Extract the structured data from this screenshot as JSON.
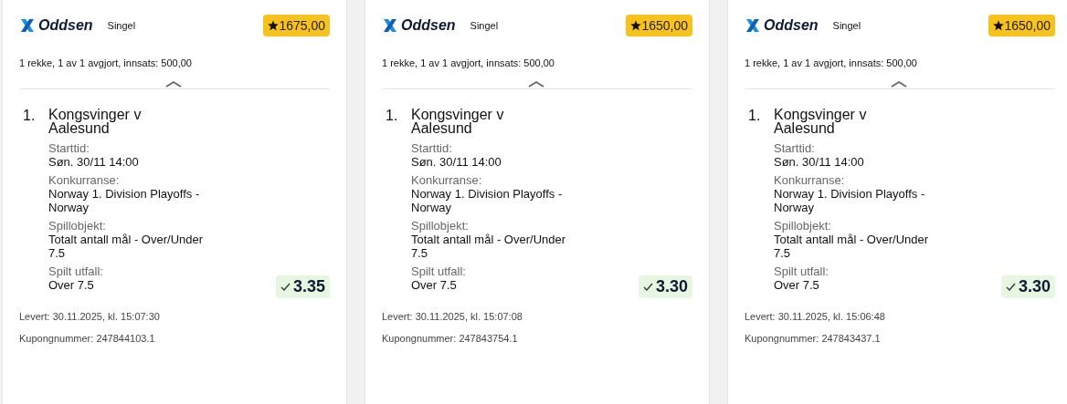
{
  "coupons": [
    {
      "brand": "Oddsen",
      "type": "Singel",
      "payout": "1675,00",
      "summary": "1 rekke, 1 av 1 avgjort, innsats: 500,00",
      "expanded": true,
      "bets": [
        {
          "number": "1.",
          "event": "Kongsvinger v Aalesund",
          "fields": [
            {
              "label": "Starttid:",
              "value": "Søn. 30/11 14:00"
            },
            {
              "label": "Konkurranse:",
              "value": "Norway 1. Division Playoffs - Norway"
            },
            {
              "label": "Spillobjekt:",
              "value": "Totalt antall mål - Over/Under 7.5"
            },
            {
              "label": "Spilt utfall:",
              "value": "Over 7.5"
            }
          ],
          "odds": "3.35",
          "won": true
        }
      ],
      "delivered": "Levert: 30.11.2025, kl. 15:07:30",
      "coupon_number": "Kupongnummer: 247844103.1"
    },
    {
      "brand": "Oddsen",
      "type": "Singel",
      "payout": "1650,00",
      "summary": "1 rekke, 1 av 1 avgjort, innsats: 500,00",
      "expanded": true,
      "bets": [
        {
          "number": "1.",
          "event": "Kongsvinger v Aalesund",
          "fields": [
            {
              "label": "Starttid:",
              "value": "Søn. 30/11 14:00"
            },
            {
              "label": "Konkurranse:",
              "value": "Norway 1. Division Playoffs - Norway"
            },
            {
              "label": "Spillobjekt:",
              "value": "Totalt antall mål - Over/Under 7.5"
            },
            {
              "label": "Spilt utfall:",
              "value": "Over 7.5"
            }
          ],
          "odds": "3.30",
          "won": true
        }
      ],
      "delivered": "Levert: 30.11.2025, kl. 15:07:08",
      "coupon_number": "Kupongnummer: 247843754.1"
    },
    {
      "brand": "Oddsen",
      "type": "Singel",
      "payout": "1650,00",
      "summary": "1 rekke, 1 av 1 avgjort, innsats: 500,00",
      "expanded": true,
      "bets": [
        {
          "number": "1.",
          "event": "Kongsvinger v Aalesund",
          "fields": [
            {
              "label": "Starttid:",
              "value": "Søn. 30/11 14:00"
            },
            {
              "label": "Konkurranse:",
              "value": "Norway 1. Division Playoffs - Norway"
            },
            {
              "label": "Spillobjekt:",
              "value": "Totalt antall mål - Over/Under 7.5"
            },
            {
              "label": "Spilt utfall:",
              "value": "Over 7.5"
            }
          ],
          "odds": "3.30",
          "won": true
        }
      ],
      "delivered": "Levert: 30.11.2025, kl. 15:06:48",
      "coupon_number": "Kupongnummer: 247843437.1"
    }
  ]
}
